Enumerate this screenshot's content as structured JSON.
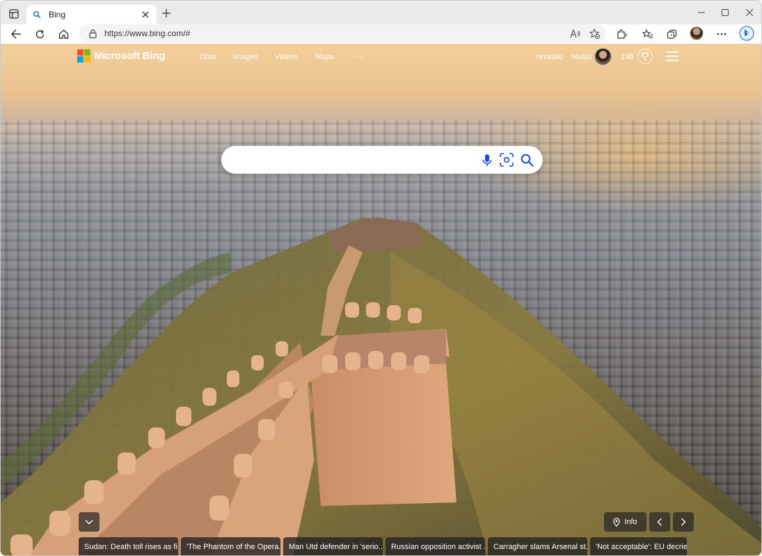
{
  "browser": {
    "tab_title": "Bing",
    "url": "https://www.bing.com/#"
  },
  "bing": {
    "brand": "Microsoft Bing",
    "nav": [
      "Chat",
      "Images",
      "Videos",
      "Maps"
    ],
    "nav_more": "···",
    "language": "hrvatski",
    "user_name": "Matija",
    "points": "198",
    "logo_colors": [
      "#f25022",
      "#7fba00",
      "#00a4ef",
      "#ffb900"
    ]
  },
  "search": {
    "value": "",
    "placeholder": "",
    "accent": "#174ae4"
  },
  "info_button": "Info",
  "news": [
    "Sudan: Death toll rises as fi...",
    "'The Phantom of the Opera...",
    "Man Utd defender in 'serio...",
    "Russian opposition activist ...",
    "Carragher slams Arsenal st...",
    "'Not acceptable': EU decrie..."
  ]
}
